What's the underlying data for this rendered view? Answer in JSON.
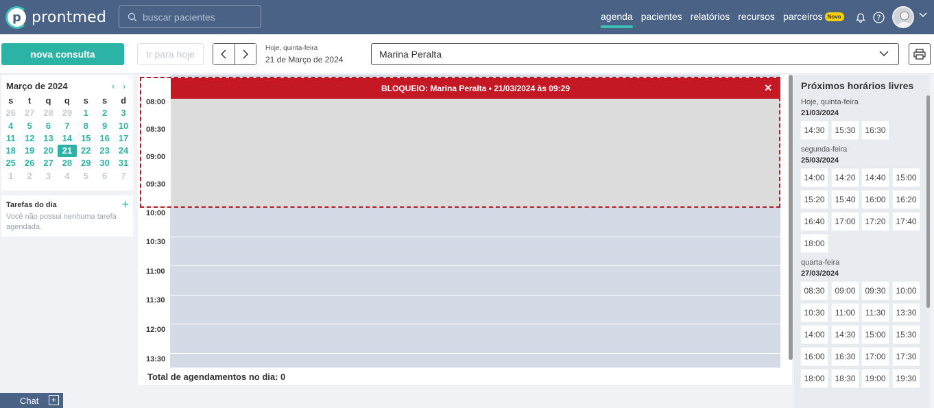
{
  "app": {
    "logo_text": "prontmed",
    "logo_letter": "p"
  },
  "search": {
    "placeholder": "buscar pacientes"
  },
  "nav": {
    "items": [
      "agenda",
      "pacientes",
      "relatórios",
      "recursos",
      "parceiros"
    ],
    "active": "agenda",
    "new_badge": "Novo"
  },
  "colors": {
    "header": "#4a6286",
    "accent": "#2bb3a5",
    "block": "#c41925"
  },
  "toolbar": {
    "new_button": "nova consulta",
    "today_button": "Ir para hoje",
    "date_caption": "Hoje, quinta-feira",
    "date_full": "21 de Março de 2024",
    "professional": "Marina Peralta"
  },
  "calendar": {
    "title": "Março de 2024",
    "weekdays": [
      "s",
      "t",
      "q",
      "q",
      "s",
      "s",
      "d"
    ],
    "weeks": [
      [
        [
          "26",
          "out"
        ],
        [
          "27",
          "out"
        ],
        [
          "28",
          "out"
        ],
        [
          "29",
          "out"
        ],
        [
          "1",
          "in"
        ],
        [
          "2",
          "in"
        ],
        [
          "3",
          "in"
        ]
      ],
      [
        [
          "4",
          "in"
        ],
        [
          "5",
          "in"
        ],
        [
          "6",
          "in"
        ],
        [
          "7",
          "in"
        ],
        [
          "8",
          "in"
        ],
        [
          "9",
          "in"
        ],
        [
          "10",
          "in"
        ]
      ],
      [
        [
          "11",
          "in"
        ],
        [
          "12",
          "in"
        ],
        [
          "13",
          "in"
        ],
        [
          "14",
          "in"
        ],
        [
          "15",
          "in"
        ],
        [
          "16",
          "in"
        ],
        [
          "17",
          "in"
        ]
      ],
      [
        [
          "18",
          "in"
        ],
        [
          "19",
          "in"
        ],
        [
          "20",
          "in"
        ],
        [
          "21",
          "sel"
        ],
        [
          "22",
          "in"
        ],
        [
          "23",
          "in"
        ],
        [
          "24",
          "in"
        ]
      ],
      [
        [
          "25",
          "in"
        ],
        [
          "26",
          "in"
        ],
        [
          "27",
          "in"
        ],
        [
          "28",
          "in"
        ],
        [
          "29",
          "in"
        ],
        [
          "30",
          "in"
        ],
        [
          "31",
          "in"
        ]
      ],
      [
        [
          "1",
          "out"
        ],
        [
          "2",
          "out"
        ],
        [
          "3",
          "out"
        ],
        [
          "4",
          "out"
        ],
        [
          "5",
          "out"
        ],
        [
          "6",
          "out"
        ],
        [
          "7",
          "out"
        ]
      ]
    ]
  },
  "tasks": {
    "title": "Tarefas do dia",
    "empty": "Você não possui nenhuma tarefa agendada."
  },
  "schedule": {
    "times": [
      "08:00",
      "08:30",
      "09:00",
      "09:30",
      "10:00",
      "10:30",
      "11:00",
      "11:30",
      "12:00",
      "13:30"
    ],
    "block_title": "BLOQUEIO: Marina Peralta • 21/03/2024 às 09:29",
    "total": "Total de agendamentos no dia: 0"
  },
  "free_slots": {
    "title": "Próximos horários livres",
    "days": [
      {
        "label": "Hoje, quinta-feira",
        "date": "21/03/2024",
        "times": [
          "14:30",
          "15:30",
          "16:30"
        ]
      },
      {
        "label": "segunda-feira",
        "date": "25/03/2024",
        "times": [
          "14:00",
          "14:20",
          "14:40",
          "15:00",
          "15:20",
          "15:40",
          "16:00",
          "16:20",
          "16:40",
          "17:00",
          "17:20",
          "17:40",
          "18:00"
        ]
      },
      {
        "label": "quarta-feira",
        "date": "27/03/2024",
        "times": [
          "08:30",
          "09:00",
          "09:30",
          "10:00",
          "10:30",
          "11:00",
          "11:30",
          "13:30",
          "14:00",
          "14:30",
          "15:00",
          "15:30",
          "16:00",
          "16:30",
          "17:00",
          "17:30",
          "18:00",
          "18:30",
          "19:00",
          "19:30"
        ]
      }
    ]
  },
  "chat": {
    "label": "Chat"
  }
}
